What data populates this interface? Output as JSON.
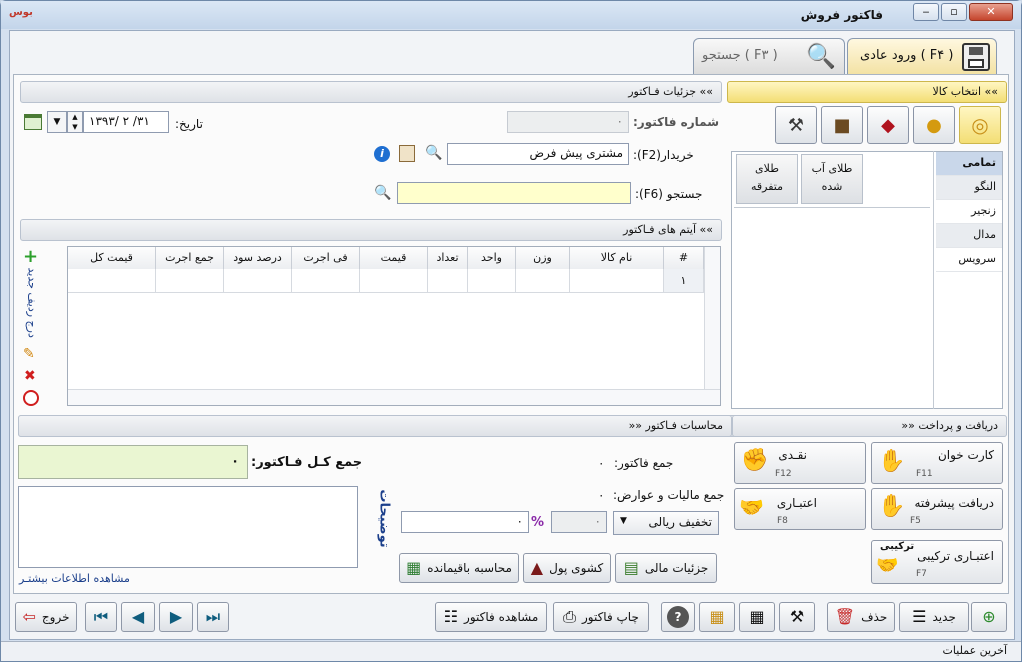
{
  "window": {
    "title": "فاکتور فروش",
    "app_logo": "بوس",
    "min_label": "‒",
    "max_label": "▫",
    "close_label": "✕"
  },
  "tabs": [
    {
      "label": "ورود عادی ( F۴ )",
      "icon": "save-icon"
    },
    {
      "label": "جستجو ( F۳ )",
      "icon": "search-icon"
    }
  ],
  "left_panel": {
    "header": "»» جزئیات فـاکتور",
    "invoice_no_label": "شماره فاکتور:",
    "invoice_no_value": "۰",
    "date_label": "تاریخ:",
    "date_value": "۱۳۹۳/ ۲ /۳۱",
    "buyer_label": "خریدار(F2):",
    "buyer_value": "مشتری پیش فرض",
    "search_label": "جستجو (F6):",
    "search_value": "",
    "items_header": "»» آیتم های فـاکتور"
  },
  "grid": {
    "columns": [
      "#",
      "نام کالا",
      "وزن",
      "واحد",
      "تعداد",
      "قیمت",
      "فی اجرت",
      "درصد سود",
      "جمع اجرت",
      "قیمت کل"
    ],
    "rows": [
      [
        "۱",
        "",
        "",
        "",
        "",
        "",
        "",
        "",
        "",
        ""
      ]
    ]
  },
  "side_tools": {
    "add_row_label": "درج ردیف جدید"
  },
  "right_panel": {
    "header": "»» انتخاب کالا",
    "categories": [
      "تمامی کالاها",
      "النگو",
      "زنجیر",
      "مدال",
      "سرویس"
    ],
    "products": [
      {
        "line1": "طلای آب",
        "line2": "شده"
      },
      {
        "line1": "طلای",
        "line2": "متفرقه"
      }
    ],
    "product_type_icons": [
      "rings-icon",
      "coins-icon",
      "diamond-icon",
      "box-icon",
      "hammer-icon"
    ]
  },
  "payment": {
    "header": "»» دریافت و پرداخت",
    "calc_header": "»» محاسبات فـاکتور",
    "total_label": "جمع کـل فـاکتور:",
    "total_value": "۰",
    "notes_label": "توضیحات",
    "more_info_link": "مشاهده اطلاعات بیشتـر",
    "invoice_sum_label": "جمع فاکتور:",
    "invoice_sum_value": "۰",
    "tax_label": "جمع مالیات و عوارض:",
    "tax_value": "۰",
    "discount_select": "تخفیف ریالی",
    "discount_value": "۰",
    "percent_sign": "%",
    "discount_percent_value": "۰",
    "buttons": [
      {
        "label": "کارت خوان",
        "key": "F11"
      },
      {
        "label": "نقـدی",
        "key": "F12"
      },
      {
        "label": "دریافت پیشرفته",
        "key": "F5"
      },
      {
        "label": "اعتبـاری",
        "key": "F8"
      },
      {
        "label": "اعتبـاری ترکیبی",
        "key": "F7",
        "extra": "ترکیبی"
      }
    ],
    "action_buttons": [
      "جزئیات مالی",
      "کشوی پول",
      "محاسبه باقیمانده"
    ]
  },
  "toolbar": {
    "new_label": "جدید",
    "delete_label": "حذف",
    "print_label": "چاپ فاکتور",
    "view_label": "مشاهده فاکتور",
    "exit_label": "خروج",
    "help_label": "?"
  },
  "status": {
    "text": "آخرین عملیات"
  },
  "colors": {
    "accent_yellow": "#f3de75",
    "total_bg": "#eaf6d2",
    "search_bg": "#ffffcc"
  }
}
